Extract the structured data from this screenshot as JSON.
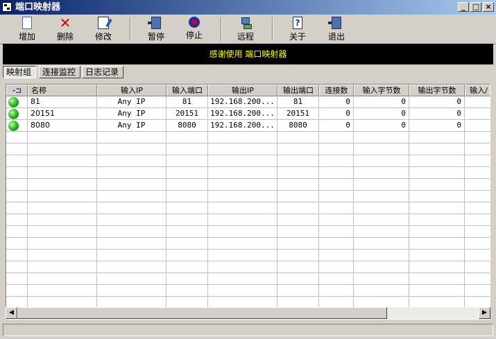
{
  "window": {
    "title": "端口映射器"
  },
  "toolbar": {
    "buttons": [
      {
        "id": "add",
        "label": "增加",
        "icon": "new-document-icon"
      },
      {
        "id": "delete",
        "label": "删除",
        "icon": "red-x-icon"
      },
      {
        "id": "edit",
        "label": "修改",
        "icon": "edit-icon"
      },
      {
        "id": "pause",
        "label": "暂停",
        "icon": "door-pause-icon"
      },
      {
        "id": "stop",
        "label": "停止",
        "icon": "stop-icon"
      },
      {
        "id": "remote",
        "label": "远程",
        "icon": "network-icon"
      },
      {
        "id": "about",
        "label": "关于",
        "icon": "help-icon"
      },
      {
        "id": "exit",
        "label": "退出",
        "icon": "exit-door-icon"
      }
    ]
  },
  "banner": {
    "text": "感谢使用 端口映射器"
  },
  "tabs": [
    {
      "label": "映射组",
      "active": true
    },
    {
      "label": "连接监控",
      "active": false
    },
    {
      "label": "日志记录",
      "active": false
    }
  ],
  "table": {
    "columns": [
      "名称",
      "输入IP",
      "输入端口",
      "输出IP",
      "输出端口",
      "连接数",
      "输入字节数",
      "输出字节数",
      "输入/"
    ],
    "rows": [
      {
        "status": "green",
        "name": "81",
        "in_ip": "Any IP",
        "in_port": "81",
        "out_ip": "192.168.200...",
        "out_port": "81",
        "connections": "0",
        "in_bytes": "0",
        "out_bytes": "0"
      },
      {
        "status": "green",
        "name": "20151",
        "in_ip": "Any IP",
        "in_port": "20151",
        "out_ip": "192.168.200...",
        "out_port": "20151",
        "connections": "0",
        "in_bytes": "0",
        "out_bytes": "0"
      },
      {
        "status": "green",
        "name": "8080",
        "in_ip": "Any IP",
        "in_port": "8080",
        "out_ip": "192.168.200...",
        "out_port": "8080",
        "connections": "0",
        "in_bytes": "0",
        "out_bytes": "0"
      }
    ]
  },
  "colors": {
    "banner_bg": "#000000",
    "banner_text": "#ffff00",
    "status_active": "#20b020"
  }
}
